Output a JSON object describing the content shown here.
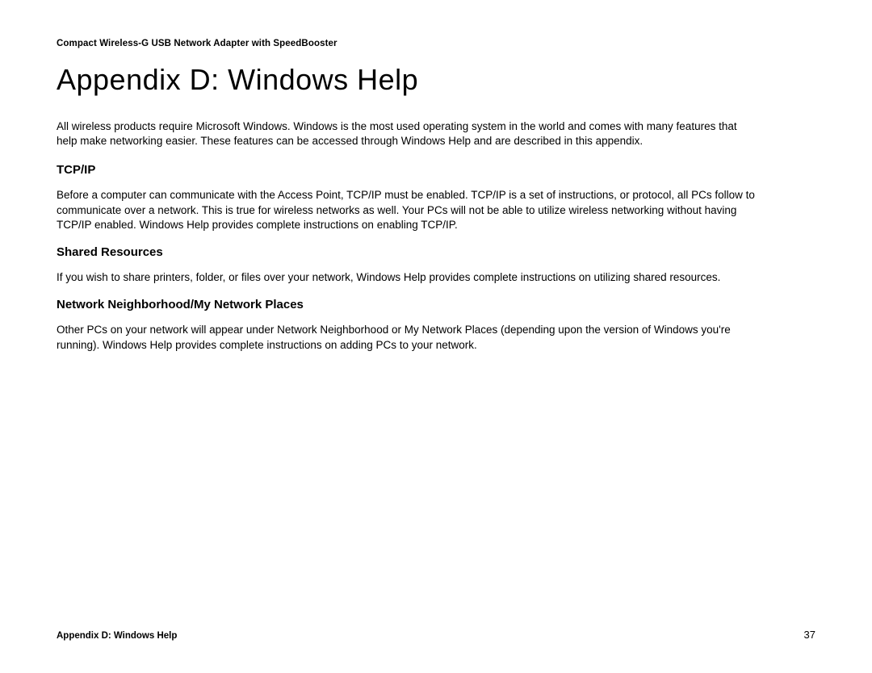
{
  "header": {
    "product_name": "Compact Wireless-G USB Network Adapter with SpeedBooster"
  },
  "title": "Appendix D: Windows Help",
  "intro": "All wireless products require Microsoft Windows. Windows is the most used operating system in the world and comes with many features that help make networking easier. These features can be accessed through Windows Help and are described in this appendix.",
  "sections": [
    {
      "heading": "TCP/IP",
      "body": "Before a computer can communicate with the Access Point, TCP/IP must be enabled. TCP/IP is a set of instructions, or protocol, all PCs follow to communicate over a network. This is true for wireless networks as well. Your PCs will not be able to utilize wireless networking without having TCP/IP enabled. Windows Help provides complete instructions on enabling TCP/IP."
    },
    {
      "heading": "Shared Resources",
      "body": "If you wish to share printers, folder, or files over your network, Windows Help provides complete instructions on utilizing shared resources."
    },
    {
      "heading": "Network Neighborhood/My Network Places",
      "body": "Other PCs on your network will appear under Network Neighborhood or My Network Places (depending upon the version of Windows you're running). Windows Help provides complete instructions on adding PCs to your network."
    }
  ],
  "footer": {
    "left": "Appendix D: Windows Help",
    "page_number": "37"
  }
}
